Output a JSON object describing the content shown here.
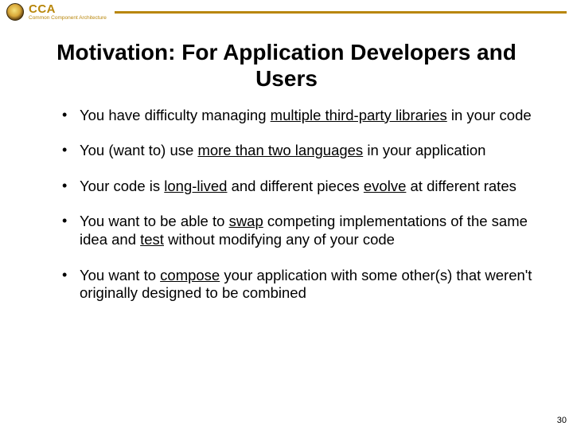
{
  "header": {
    "acronym": "CCA",
    "subtitle": "Common Component Architecture"
  },
  "title": "Motivation: For Application Developers and Users",
  "bullets": [
    {
      "pre": "You have difficulty managing ",
      "u1": "multiple third-party libraries",
      "mid": " in your code",
      "u2": "",
      "mid2": "",
      "u3": "",
      "post": ""
    },
    {
      "pre": "You (want to) use ",
      "u1": "more than two languages",
      "mid": " in your application",
      "u2": "",
      "mid2": "",
      "u3": "",
      "post": ""
    },
    {
      "pre": "Your code is ",
      "u1": "long-lived",
      "mid": " and different pieces ",
      "u2": "evolve",
      "mid2": " at different rates",
      "u3": "",
      "post": ""
    },
    {
      "pre": "You want to be able to ",
      "u1": "swap",
      "mid": " competing implementations of the same idea and ",
      "u2": "test",
      "mid2": " without modifying any of your code",
      "u3": "",
      "post": ""
    },
    {
      "pre": "You want to ",
      "u1": "compose",
      "mid": " your application with some other(s) that weren't originally designed to be combined",
      "u2": "",
      "mid2": "",
      "u3": "",
      "post": ""
    }
  ],
  "page_number": "30"
}
